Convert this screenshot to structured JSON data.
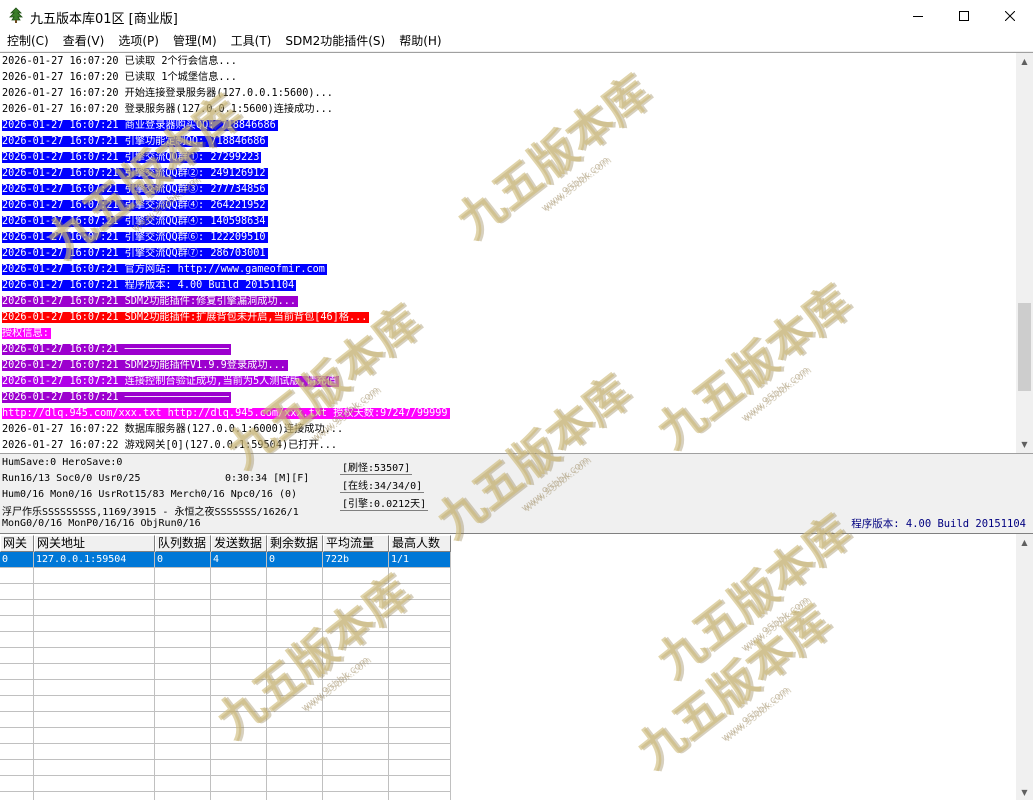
{
  "window": {
    "title": "九五版本库01区 [商业版]"
  },
  "menu": [
    {
      "label": "控制(C)"
    },
    {
      "label": "查看(V)"
    },
    {
      "label": "选项(P)"
    },
    {
      "label": "管理(M)"
    },
    {
      "label": "工具(T)"
    },
    {
      "label": "SDM2功能插件(S)"
    },
    {
      "label": "帮助(H)"
    }
  ],
  "log": [
    {
      "text": "2026-01-27 16:07:20 已读取 2个行会信息...",
      "style": ""
    },
    {
      "text": "2026-01-27 16:07:20 已读取 1个城堡信息...",
      "style": ""
    },
    {
      "text": "2026-01-27 16:07:20 开始连接登录服务器(127.0.0.1:5600)...",
      "style": ""
    },
    {
      "text": "2026-01-27 16:07:20 登录服务器(127.0.0.1:5600)连接成功...",
      "style": ""
    },
    {
      "text": "2026-01-27 16:07:21 商业登录器购买QQ: 718846686",
      "style": "hl-blue"
    },
    {
      "text": "2026-01-27 16:07:21 引擎功能定制QQ: 718846686",
      "style": "hl-blue"
    },
    {
      "text": "2026-01-27 16:07:21 引擎交流QQ群①: 27299223",
      "style": "hl-blue"
    },
    {
      "text": "2026-01-27 16:07:21 引擎交流QQ群②: 249126912",
      "style": "hl-blue"
    },
    {
      "text": "2026-01-27 16:07:21 引擎交流QQ群③: 277734856",
      "style": "hl-blue"
    },
    {
      "text": "2026-01-27 16:07:21 引擎交流QQ群④: 264221952",
      "style": "hl-blue"
    },
    {
      "text": "2026-01-27 16:07:21 引擎交流QQ群④: 140598634",
      "style": "hl-blue"
    },
    {
      "text": "2026-01-27 16:07:21 引擎交流QQ群⑥: 122209510",
      "style": "hl-blue"
    },
    {
      "text": "2026-01-27 16:07:21 引擎交流QQ群⑦: 286703001",
      "style": "hl-blue"
    },
    {
      "text": "2026-01-27 16:07:21 官方网站: http://www.gameofmir.com",
      "style": "hl-blue"
    },
    {
      "text": "2026-01-27 16:07:21 程序版本: 4.00 Build 20151104",
      "style": "hl-blue"
    },
    {
      "text": "2026-01-27 16:07:21 SDM2功能插件:修复引擎漏洞成功...",
      "style": "hl-purple"
    },
    {
      "text": "2026-01-27 16:07:21 SDM2功能插件:扩展背包未开启,当前背包[46]格...",
      "style": "hl-red"
    },
    {
      "text": "授权信息:",
      "style": "hl-magenta"
    },
    {
      "text": "2026-01-27 16:07:21 ─────────────────",
      "style": "hl-purple"
    },
    {
      "text": "2026-01-27 16:07:21 SDM2功能插件V1.9.9登录成功...",
      "style": "hl-purple"
    },
    {
      "text": "2026-01-27 16:07:21 连接控制台验证成功,当前为5人测试版,请充值",
      "style": "hl-violet"
    },
    {
      "text": "2026-01-27 16:07:21 ─────────────────",
      "style": "hl-purple"
    },
    {
      "text": "http://dlq.945.com/xxx.txt http://dlq.945.com/xxx.txt 授权天数:97247/99999",
      "style": "hl-magenta"
    },
    {
      "text": "2026-01-27 16:07:22 数据库服务器(127.0.0.1:6000)连接成功...",
      "style": ""
    },
    {
      "text": "2026-01-27 16:07:22 游戏网关[0](127.0.0.1:59504)已打开...",
      "style": ""
    }
  ],
  "status": {
    "hum_save": "HumSave:0 HeroSave:0",
    "run": "Run16/13 Soc0/0 Usr0/25",
    "time": "0:30:34 [M][F]",
    "hum": "Hum0/16 Mon0/16 UsrRot15/83 Merch0/16 Npc0/16 (0)",
    "map_line": "浮尸作乐SSSSSSSSS,1169/3915 - 永恒之夜SSSSSSS/1626/1",
    "mon": "MonG0/0/16 MonP0/16/16 ObjRun0/16",
    "refresh": "[刷怪:53507]",
    "online": "[在线:34/34/0]",
    "engine": "[引擎:0.0212天]",
    "version": "程序版本: 4.00 Build 20151104"
  },
  "grid": {
    "headers": [
      "网关",
      "网关地址",
      "队列数据",
      "发送数据",
      "剩余数据",
      "平均流量",
      "最高人数"
    ],
    "rows": [
      [
        "0",
        "127.0.0.1:59504",
        "0",
        "4",
        "0",
        "722b",
        "1/1"
      ]
    ],
    "empty_rows": 15
  },
  "watermark": {
    "text": "九五版本库",
    "sub": "www.95bbk.com"
  }
}
